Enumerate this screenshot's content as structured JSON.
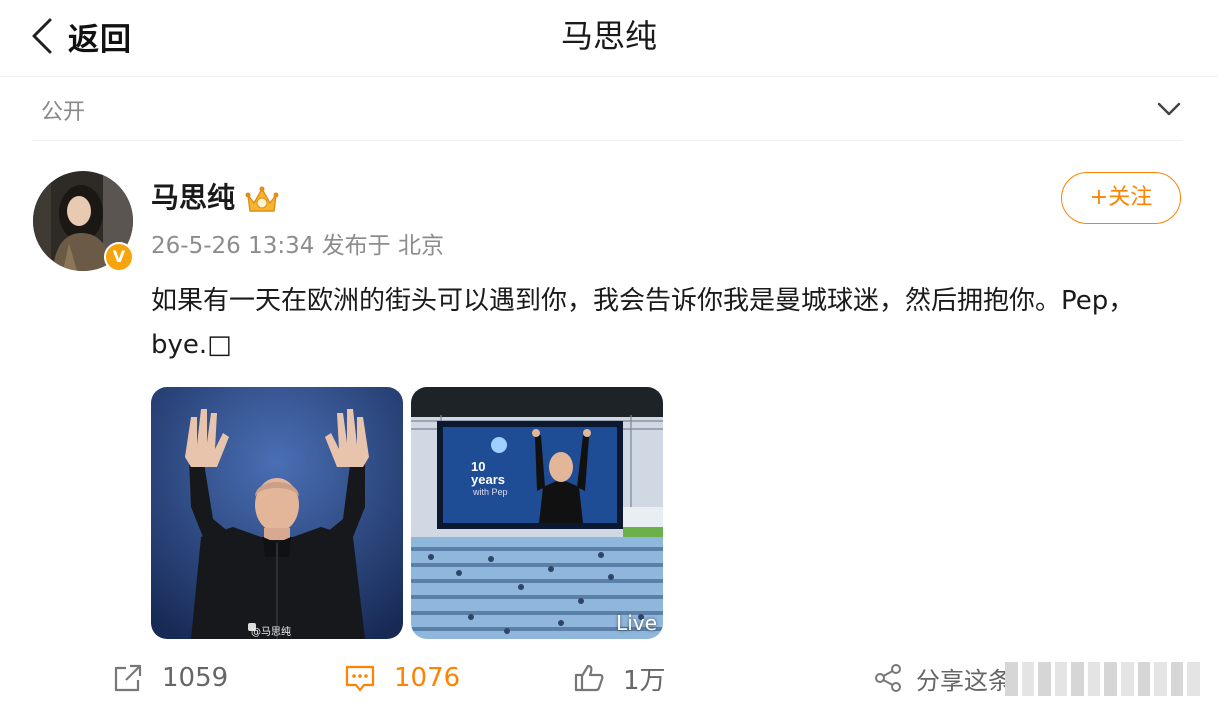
{
  "nav": {
    "back_label": "返回",
    "title": "马思纯"
  },
  "visibility": {
    "label": "公开"
  },
  "post": {
    "username": "马思纯",
    "verified_badge": "V",
    "meta": "26-5-26 13:34 发布于 北京",
    "follow_label": "+关注",
    "text": "如果有一天在欧洲的街头可以遇到你，我会告诉你我是曼城球迷，然后拥抱你。Pep，bye.□",
    "images": [
      {
        "watermark": "@马思纯"
      },
      {
        "screen_number": "10",
        "screen_years": "years",
        "screen_sub": "with Pep",
        "badge": "Live"
      }
    ]
  },
  "actions": {
    "repost_count": "1059",
    "comment_count": "1076",
    "like_count": "1万",
    "share_label": "分享这条"
  },
  "colors": {
    "accent": "#ff8200",
    "badge": "#f7a30b",
    "muted": "#8c8c8c"
  }
}
